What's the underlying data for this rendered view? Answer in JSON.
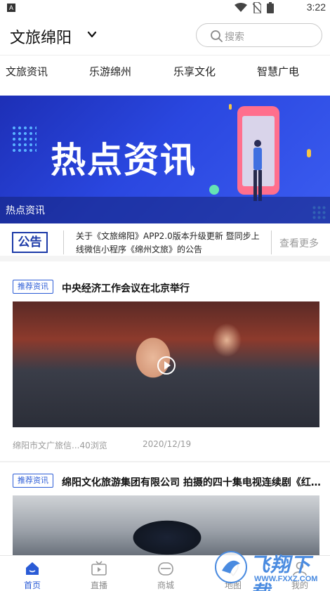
{
  "status_bar": {
    "app_badge": "A",
    "time": "3:22",
    "icons": [
      "wifi-icon",
      "sim-off-icon",
      "battery-icon"
    ]
  },
  "header": {
    "title": "文旅绵阳",
    "search_placeholder": "搜索"
  },
  "tabs": [
    {
      "label": "文旅资讯"
    },
    {
      "label": "乐游绵州"
    },
    {
      "label": "乐享文化"
    },
    {
      "label": "智慧广电"
    }
  ],
  "banner": {
    "headline": "热点资讯",
    "caption": "热点资讯"
  },
  "notice": {
    "badge": "公告",
    "text": "关于《文旅绵阳》APP2.0版本升级更新 暨同步上线微信小程序《绵州文旅》的公告",
    "more": "查看更多"
  },
  "articles": [
    {
      "tag": "推荐资讯",
      "title": "中央经济工作会议在北京举行",
      "source_views": "绵阳市文广旅信...40浏览",
      "date": "2020/12/19"
    },
    {
      "tag": "推荐资讯",
      "title": "绵阳文化旅游集团有限公司 拍摄的四十集电视连续剧《红..."
    }
  ],
  "bottom_nav": [
    {
      "label": "首页",
      "icon": "home-icon"
    },
    {
      "label": "直播",
      "icon": "live-tv-icon"
    },
    {
      "label": "商城",
      "icon": "shop-icon"
    },
    {
      "label": "地图",
      "icon": "map-icon"
    },
    {
      "label": "我的",
      "icon": "profile-icon"
    }
  ],
  "watermark": {
    "text": "飞翔下载",
    "url": "WWW.FXXZ.COM"
  },
  "colors": {
    "accent": "#2a5bd6",
    "notice_badge": "#1c3aa8",
    "banner": "#2a47e0"
  }
}
